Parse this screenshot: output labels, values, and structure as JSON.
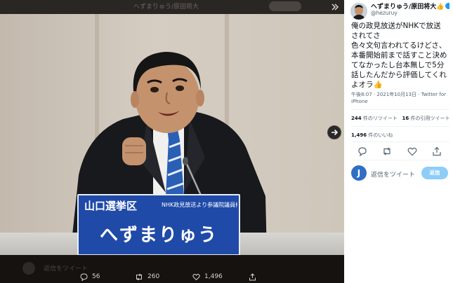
{
  "viewer": {
    "top_ghost_text": "へずまりゅう/原田将大",
    "nameplate": {
      "district": "山口選挙区",
      "small_text": "NHK政見放送より参議院議員候補者",
      "name": "へずまりゅう"
    },
    "bottom_ghost_reply": "返信をツイート",
    "actions": {
      "reply_count": "56",
      "retweet_count": "260",
      "like_count": "1,496"
    }
  },
  "tweet": {
    "display_name": "へずまりゅう/原田将大👍",
    "handle": "@hezuruy",
    "text": "俺の政見放送がNHKで放送されてさ\n色々文句言われてるけどさ、本番開始前まで話すこと決めてなかったし台本無しで5分話したんだから評価してくれよオラ👍",
    "meta": "午後8:07 · 2021年10月13日 · Twitter for iPhone",
    "retweets_count": "244",
    "retweets_label": "件のリツイート",
    "quotes_count": "16",
    "quotes_label": "件の引用ツイート",
    "likes_count": "1,496",
    "likes_label": "件のいいね",
    "reply_avatar_letter": "J",
    "reply_placeholder": "返信をツイート",
    "reply_button": "返信"
  },
  "colors": {
    "accent": "#1d9bf0",
    "reply_button": "#8ecdf8",
    "nameplate": "#1f4aa8",
    "viewer_bg": "#1a1714"
  },
  "icons": [
    "expand-icon",
    "next-arrow-icon",
    "reply-icon",
    "retweet-icon",
    "like-icon",
    "share-icon"
  ]
}
